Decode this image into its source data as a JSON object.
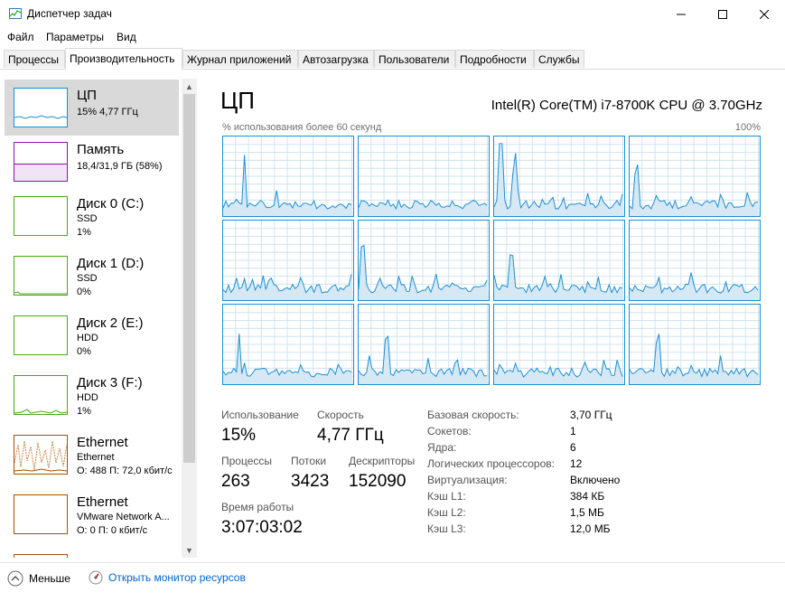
{
  "window": {
    "title": "Диспетчер задач"
  },
  "menu": [
    "Файл",
    "Параметры",
    "Вид"
  ],
  "tabs": [
    "Процессы",
    "Производительность",
    "Журнал приложений",
    "Автозагрузка",
    "Пользователи",
    "Подробности",
    "Службы"
  ],
  "active_tab": "Производительность",
  "sidebar": [
    {
      "title": "ЦП",
      "line1": "15% 4,77 ГГц",
      "line2": "",
      "color": "#1b8fd2"
    },
    {
      "title": "Память",
      "line1": "18,4/31,9 ГБ (58%)",
      "line2": "",
      "color": "#8b12ae"
    },
    {
      "title": "Диск 0 (C:)",
      "line1": "SSD",
      "line2": "1%",
      "color": "#4ea717"
    },
    {
      "title": "Диск 1 (D:)",
      "line1": "SSD",
      "line2": "0%",
      "color": "#4ea717"
    },
    {
      "title": "Диск 2 (E:)",
      "line1": "HDD",
      "line2": "0%",
      "color": "#4ea717"
    },
    {
      "title": "Диск 3 (F:)",
      "line1": "HDD",
      "line2": "1%",
      "color": "#4ea717"
    },
    {
      "title": "Ethernet",
      "line1": "Ethernet",
      "line2": "О: 488 П: 72,0 кбит/с",
      "color": "#a74f01"
    },
    {
      "title": "Ethernet",
      "line1": "VMware Network A...",
      "line2": "О: 0 П: 0 кбит/с",
      "color": "#a74f01"
    }
  ],
  "main": {
    "title": "ЦП",
    "cpu_model": "Intel(R) Core(TM) i7-8700K CPU @ 3.70GHz",
    "graph_label": "% использования более 60 секунд",
    "graph_max": "100%",
    "stats": {
      "usage_label": "Использование",
      "usage": "15%",
      "speed_label": "Скорость",
      "speed": "4,77 ГГц",
      "processes_label": "Процессы",
      "processes": "263",
      "threads_label": "Потоки",
      "threads": "3423",
      "handles_label": "Дескрипторы",
      "handles": "152090",
      "uptime_label": "Время работы",
      "uptime": "3:07:03:02"
    },
    "specs": [
      {
        "label": "Базовая скорость:",
        "value": "3,70 ГГц"
      },
      {
        "label": "Сокетов:",
        "value": "1"
      },
      {
        "label": "Ядра:",
        "value": "6"
      },
      {
        "label": "Логических процессоров:",
        "value": "12"
      },
      {
        "label": "Виртуализация:",
        "value": "Включено"
      },
      {
        "label": "Кэш L1:",
        "value": "384 КБ"
      },
      {
        "label": "Кэш L2:",
        "value": "1,5 МБ"
      },
      {
        "label": "Кэш L3:",
        "value": "12,0 МБ"
      }
    ]
  },
  "footer": {
    "less": "Меньше",
    "monitor": "Открыть монитор ресурсов"
  },
  "colors": {
    "cpu": "#1b8fd2",
    "cpu_fill": "#d6e8f4",
    "grid": "#cfe3f1"
  }
}
